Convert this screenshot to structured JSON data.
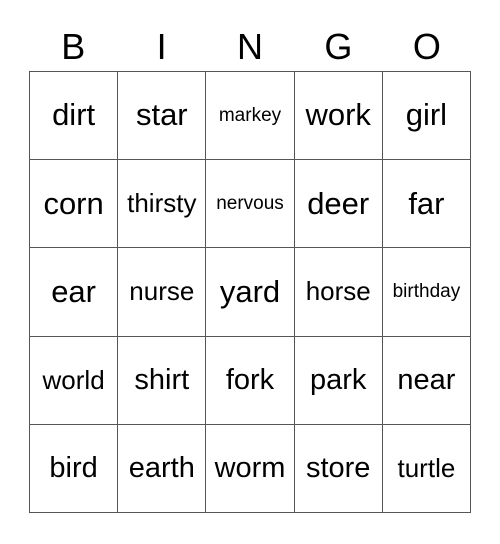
{
  "card": {
    "title": "BINGO",
    "header_letters": [
      "B",
      "I",
      "N",
      "G",
      "O"
    ],
    "columns": 5,
    "rows": 5,
    "border_color": "#555555",
    "text_color": "#000000",
    "background_color": "#ffffff",
    "grid": [
      [
        {
          "word": "dirt",
          "size": "fs-xl"
        },
        {
          "word": "star",
          "size": "fs-xl"
        },
        {
          "word": "markey",
          "size": "fs-xs"
        },
        {
          "word": "work",
          "size": "fs-xl"
        },
        {
          "word": "girl",
          "size": "fs-xl"
        }
      ],
      [
        {
          "word": "corn",
          "size": "fs-xl"
        },
        {
          "word": "thirsty",
          "size": "fs-md"
        },
        {
          "word": "nervous",
          "size": "fs-xs"
        },
        {
          "word": "deer",
          "size": "fs-xl"
        },
        {
          "word": "far",
          "size": "fs-xl"
        }
      ],
      [
        {
          "word": "ear",
          "size": "fs-xl"
        },
        {
          "word": "nurse",
          "size": "fs-md"
        },
        {
          "word": "yard",
          "size": "fs-xl"
        },
        {
          "word": "horse",
          "size": "fs-md"
        },
        {
          "word": "birthday",
          "size": "fs-xs"
        }
      ],
      [
        {
          "word": "world",
          "size": "fs-md"
        },
        {
          "word": "shirt",
          "size": "fs-lg"
        },
        {
          "word": "fork",
          "size": "fs-lg"
        },
        {
          "word": "park",
          "size": "fs-lg"
        },
        {
          "word": "near",
          "size": "fs-lg"
        }
      ],
      [
        {
          "word": "bird",
          "size": "fs-lg"
        },
        {
          "word": "earth",
          "size": "fs-lg"
        },
        {
          "word": "worm",
          "size": "fs-lg"
        },
        {
          "word": "store",
          "size": "fs-lg"
        },
        {
          "word": "turtle",
          "size": "fs-md"
        }
      ]
    ]
  }
}
